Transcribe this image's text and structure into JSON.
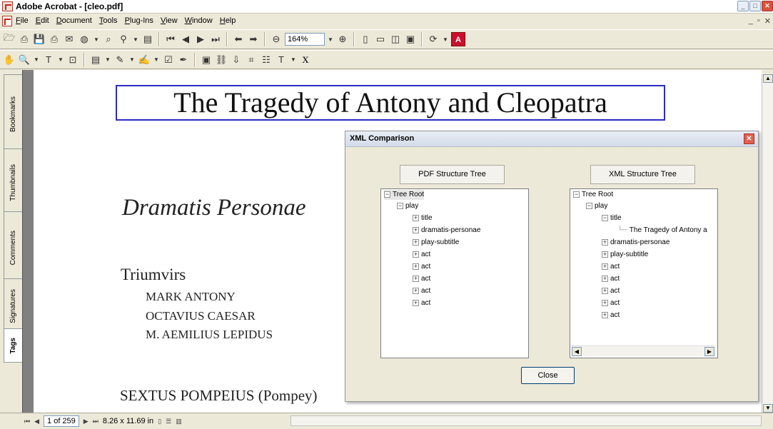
{
  "window": {
    "title": "Adobe Acrobat - [cleo.pdf]"
  },
  "menu": [
    "File",
    "Edit",
    "Document",
    "Tools",
    "Plug-Ins",
    "View",
    "Window",
    "Help"
  ],
  "toolbar": {
    "zoom": "164%",
    "adobe_logo": "Adobe"
  },
  "nav_tabs": [
    "Bookmarks",
    "Thumbnails",
    "Comments",
    "Signatures",
    "Tags"
  ],
  "document": {
    "title": "The Tragedy of Antony and Cleopatra",
    "dramatis": "Dramatis Personae",
    "group": "Triumvirs",
    "cast": [
      "MARK ANTONY",
      "OCTAVIUS CAESAR",
      "M. AEMILIUS LEPIDUS"
    ],
    "extra": "SEXTUS POMPEIUS (Pompey)"
  },
  "dialog": {
    "title": "XML Comparison",
    "pdf_tree_label": "PDF Structure Tree",
    "xml_tree_label": "XML Structure Tree",
    "close_label": "Close",
    "pdf_tree": [
      "Tree Root",
      "play",
      "title",
      "dramatis-personae",
      "play-subtitle",
      "act",
      "act",
      "act",
      "act",
      "act"
    ],
    "xml_tree": [
      "Tree Root",
      "play",
      "title",
      "The Tragedy of Antony a",
      "dramatis-personae",
      "play-subtitle",
      "act",
      "act",
      "act",
      "act",
      "act"
    ]
  },
  "status": {
    "page": "1 of 259",
    "size": "8.26 x 11.69 in"
  }
}
